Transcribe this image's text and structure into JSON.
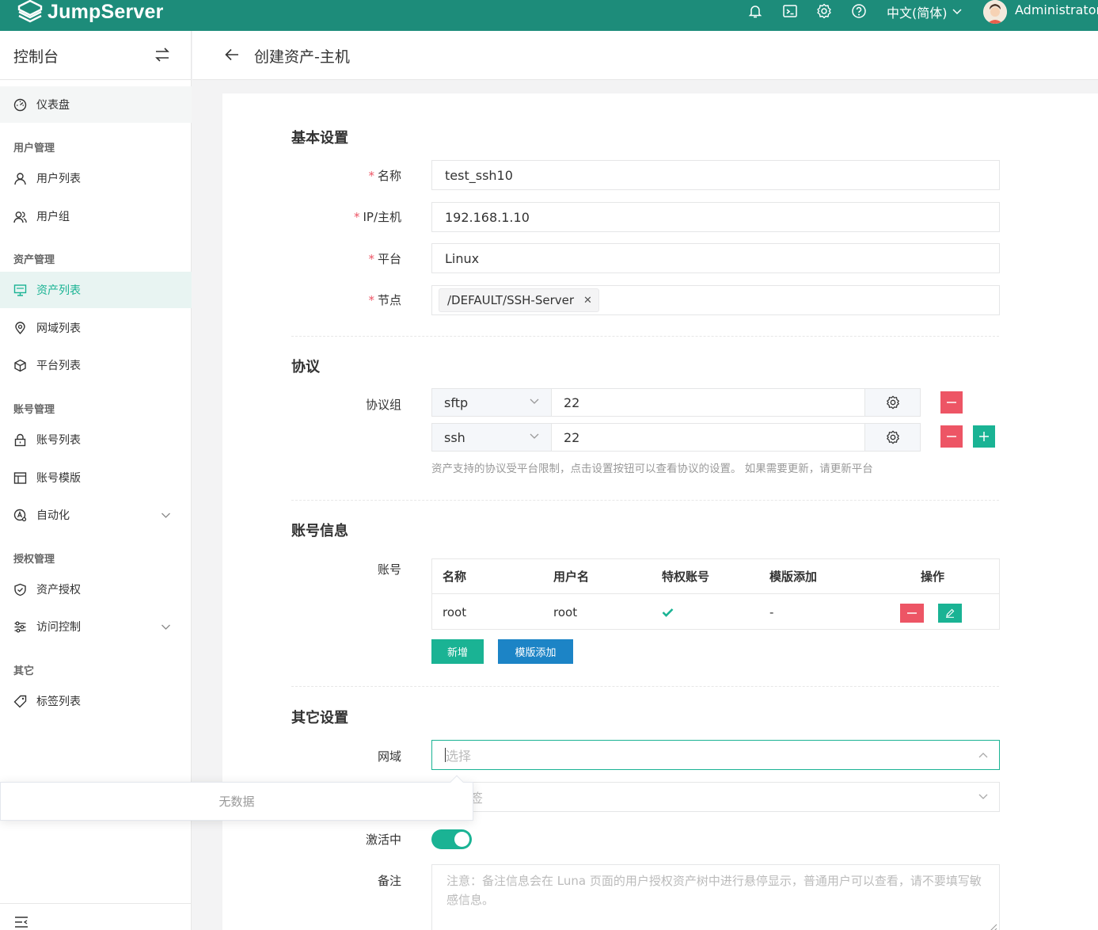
{
  "topbar": {
    "logo_text": "JumpServer",
    "language": "中文(简体)",
    "user_name": "Administrator",
    "icons": [
      "bell-icon",
      "terminal-icon",
      "settings-icon",
      "help-icon"
    ],
    "color": "#1d8c7a"
  },
  "sidebar": {
    "title": "控制台",
    "dashboard": "仪表盘",
    "groups": {
      "users": "用户管理",
      "assets": "资产管理",
      "accounts": "账号管理",
      "perms": "授权管理",
      "other": "其它"
    },
    "items": {
      "user_list": "用户列表",
      "user_group": "用户组",
      "asset_list": "资产列表",
      "domain_list": "网域列表",
      "platform_list": "平台列表",
      "account_list": "账号列表",
      "account_template": "账号模版",
      "automation": "自动化",
      "asset_perm": "资产授权",
      "access_control": "访问控制",
      "label_list": "标签列表"
    }
  },
  "page": {
    "title": "创建资产-主机"
  },
  "form": {
    "basic": {
      "title": "基本设置",
      "name_label": "名称",
      "name_value": "test_ssh10",
      "ip_label": "IP/主机",
      "ip_value": "192.168.1.10",
      "platform_label": "平台",
      "platform_value": "Linux",
      "node_label": "节点",
      "node_tag": "/DEFAULT/SSH-Server",
      "required_mark": "*"
    },
    "protocol": {
      "title": "协议",
      "group_label": "协议组",
      "rows": [
        {
          "name": "sftp",
          "port": "22"
        },
        {
          "name": "ssh",
          "port": "22"
        }
      ],
      "help": "资产支持的协议受平台限制，点击设置按钮可以查看协议的设置。 如果需要更新，请更新平台"
    },
    "account": {
      "title": "账号信息",
      "label": "账号",
      "columns": [
        "名称",
        "用户名",
        "特权账号",
        "模版添加",
        "操作"
      ],
      "rows": [
        {
          "name": "root",
          "username": "root",
          "privileged": true,
          "template": "-"
        }
      ],
      "add_button": "新增",
      "template_button": "模版添加"
    },
    "other": {
      "title": "其它设置",
      "domain_label": "网域",
      "domain_placeholder": "选择",
      "labels_placeholder": "择标签",
      "active_label": "激活中",
      "active_value": true,
      "comment_label": "备注",
      "comment_placeholder": "注意：备注信息会在 Luna 页面的用户授权资产树中进行悬停显示，普通用户可以查看，请不要填写敏感信息。"
    }
  },
  "dropdown": {
    "empty_text": "无数据"
  },
  "colors": {
    "accent": "#1ab394",
    "danger": "#ed5565",
    "primary": "#1c84c6"
  }
}
